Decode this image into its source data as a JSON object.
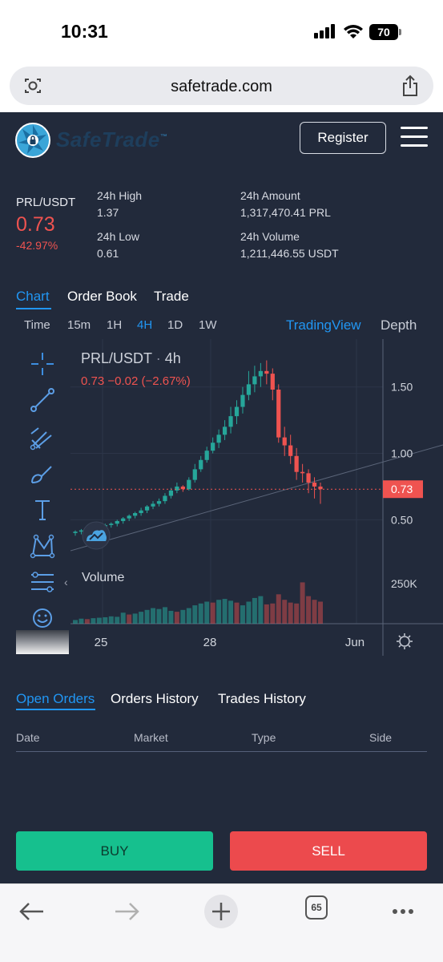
{
  "status_bar": {
    "time": "10:31",
    "battery": "70"
  },
  "browser": {
    "url": "safetrade.com",
    "tabs_count": "65"
  },
  "header": {
    "logo_text": "SafeTrade",
    "logo_tm": "™",
    "register_label": "Register"
  },
  "ticker": {
    "pair": "PRL/USDT",
    "price": "0.73",
    "change": "-42.97%",
    "high_label": "24h High",
    "high_value": "1.37",
    "low_label": "24h Low",
    "low_value": "0.61",
    "amount_label": "24h Amount",
    "amount_value": "1,317,470.41 PRL",
    "volume_label": "24h Volume",
    "volume_value": "1,211,446.55 USDT"
  },
  "main_tabs": [
    {
      "label": "Chart",
      "active": true
    },
    {
      "label": "Order Book",
      "active": false
    },
    {
      "label": "Trade",
      "active": false
    }
  ],
  "timeframes": {
    "time_label": "Time",
    "items": [
      "15m",
      "1H",
      "4H",
      "1D",
      "1W"
    ],
    "active": "4H",
    "tradingview_label": "TradingView",
    "depth_label": "Depth"
  },
  "chart": {
    "title_pair": "PRL/USDT",
    "title_sep": "·",
    "title_interval": "4h",
    "ohlc_text": "0.73  −0.02  (−2.67%)",
    "volume_label": "Volume",
    "price_ticks": [
      "1.50",
      "1.00",
      "0.50"
    ],
    "volume_tick": "250K",
    "current_price_tag": "0.73",
    "date_ticks": [
      "25",
      "28",
      "Jun"
    ]
  },
  "chart_data": {
    "type": "candlestick",
    "title": "PRL/USDT · 4h",
    "ylim": [
      0.2,
      1.8
    ],
    "current_price": 0.73,
    "y_ticks": [
      1.5,
      1.0,
      0.5
    ],
    "x_ticks": [
      "25",
      "28",
      "Jun"
    ],
    "candles": [
      {
        "o": 0.4,
        "h": 0.42,
        "c": 0.41,
        "l": 0.38
      },
      {
        "o": 0.41,
        "h": 0.43,
        "c": 0.42,
        "l": 0.39
      },
      {
        "o": 0.42,
        "h": 0.44,
        "c": 0.43,
        "l": 0.4
      },
      {
        "o": 0.43,
        "h": 0.45,
        "c": 0.44,
        "l": 0.41
      },
      {
        "o": 0.44,
        "h": 0.46,
        "c": 0.45,
        "l": 0.42
      },
      {
        "o": 0.45,
        "h": 0.47,
        "c": 0.46,
        "l": 0.43
      },
      {
        "o": 0.46,
        "h": 0.48,
        "c": 0.47,
        "l": 0.44
      },
      {
        "o": 0.47,
        "h": 0.5,
        "c": 0.49,
        "l": 0.45
      },
      {
        "o": 0.49,
        "h": 0.52,
        "c": 0.51,
        "l": 0.47
      },
      {
        "o": 0.51,
        "h": 0.54,
        "c": 0.53,
        "l": 0.49
      },
      {
        "o": 0.53,
        "h": 0.56,
        "c": 0.55,
        "l": 0.51
      },
      {
        "o": 0.55,
        "h": 0.59,
        "c": 0.57,
        "l": 0.53
      },
      {
        "o": 0.57,
        "h": 0.61,
        "c": 0.6,
        "l": 0.55
      },
      {
        "o": 0.6,
        "h": 0.64,
        "c": 0.62,
        "l": 0.58
      },
      {
        "o": 0.62,
        "h": 0.66,
        "c": 0.64,
        "l": 0.6
      },
      {
        "o": 0.64,
        "h": 0.7,
        "c": 0.68,
        "l": 0.62
      },
      {
        "o": 0.68,
        "h": 0.74,
        "c": 0.72,
        "l": 0.66
      },
      {
        "o": 0.72,
        "h": 0.78,
        "c": 0.75,
        "l": 0.7
      },
      {
        "o": 0.75,
        "h": 0.76,
        "c": 0.73,
        "l": 0.71
      },
      {
        "o": 0.73,
        "h": 0.82,
        "c": 0.8,
        "l": 0.72
      },
      {
        "o": 0.8,
        "h": 0.92,
        "c": 0.88,
        "l": 0.78
      },
      {
        "o": 0.88,
        "h": 0.98,
        "c": 0.95,
        "l": 0.86
      },
      {
        "o": 0.95,
        "h": 1.05,
        "c": 1.02,
        "l": 0.93
      },
      {
        "o": 1.02,
        "h": 1.12,
        "c": 1.08,
        "l": 1.0
      },
      {
        "o": 1.08,
        "h": 1.18,
        "c": 1.14,
        "l": 1.04
      },
      {
        "o": 1.14,
        "h": 1.25,
        "c": 1.2,
        "l": 1.1
      },
      {
        "o": 1.2,
        "h": 1.35,
        "c": 1.28,
        "l": 1.15
      },
      {
        "o": 1.28,
        "h": 1.4,
        "c": 1.35,
        "l": 1.22
      },
      {
        "o": 1.35,
        "h": 1.5,
        "c": 1.44,
        "l": 1.3
      },
      {
        "o": 1.44,
        "h": 1.62,
        "c": 1.52,
        "l": 1.4
      },
      {
        "o": 1.52,
        "h": 1.66,
        "c": 1.58,
        "l": 1.46
      },
      {
        "o": 1.58,
        "h": 1.68,
        "c": 1.62,
        "l": 1.5
      },
      {
        "o": 1.62,
        "h": 1.7,
        "c": 1.6,
        "l": 1.52
      },
      {
        "o": 1.6,
        "h": 1.64,
        "c": 1.48,
        "l": 1.4
      },
      {
        "o": 1.48,
        "h": 1.52,
        "c": 1.12,
        "l": 1.08
      },
      {
        "o": 1.12,
        "h": 1.2,
        "c": 1.06,
        "l": 0.98
      },
      {
        "o": 1.06,
        "h": 1.14,
        "c": 0.98,
        "l": 0.92
      },
      {
        "o": 0.98,
        "h": 1.04,
        "c": 0.86,
        "l": 0.8
      },
      {
        "o": 0.86,
        "h": 0.92,
        "c": 0.85,
        "l": 0.78
      },
      {
        "o": 0.85,
        "h": 0.88,
        "c": 0.78,
        "l": 0.7
      },
      {
        "o": 0.78,
        "h": 0.82,
        "c": 0.75,
        "l": 0.66
      },
      {
        "o": 0.75,
        "h": 0.78,
        "c": 0.73,
        "l": 0.62
      }
    ],
    "volume": [
      {
        "v": 40,
        "up": true
      },
      {
        "v": 55,
        "up": true
      },
      {
        "v": 50,
        "up": false
      },
      {
        "v": 60,
        "up": true
      },
      {
        "v": 65,
        "up": true
      },
      {
        "v": 70,
        "up": true
      },
      {
        "v": 80,
        "up": true
      },
      {
        "v": 75,
        "up": true
      },
      {
        "v": 120,
        "up": true
      },
      {
        "v": 100,
        "up": false
      },
      {
        "v": 110,
        "up": true
      },
      {
        "v": 130,
        "up": true
      },
      {
        "v": 150,
        "up": true
      },
      {
        "v": 170,
        "up": true
      },
      {
        "v": 160,
        "up": true
      },
      {
        "v": 180,
        "up": true
      },
      {
        "v": 140,
        "up": true
      },
      {
        "v": 130,
        "up": false
      },
      {
        "v": 150,
        "up": true
      },
      {
        "v": 170,
        "up": true
      },
      {
        "v": 200,
        "up": true
      },
      {
        "v": 220,
        "up": true
      },
      {
        "v": 240,
        "up": true
      },
      {
        "v": 230,
        "up": false
      },
      {
        "v": 260,
        "up": true
      },
      {
        "v": 270,
        "up": true
      },
      {
        "v": 250,
        "up": true
      },
      {
        "v": 230,
        "up": false
      },
      {
        "v": 200,
        "up": true
      },
      {
        "v": 240,
        "up": true
      },
      {
        "v": 280,
        "up": true
      },
      {
        "v": 300,
        "up": true
      },
      {
        "v": 210,
        "up": false
      },
      {
        "v": 220,
        "up": false
      },
      {
        "v": 320,
        "up": false
      },
      {
        "v": 260,
        "up": false
      },
      {
        "v": 230,
        "up": false
      },
      {
        "v": 220,
        "up": false
      },
      {
        "v": 450,
        "up": false
      },
      {
        "v": 300,
        "up": false
      },
      {
        "v": 260,
        "up": false
      },
      {
        "v": 240,
        "up": false
      }
    ]
  },
  "orders": {
    "tabs": [
      {
        "label": "Open Orders",
        "active": true
      },
      {
        "label": "Orders History",
        "active": false
      },
      {
        "label": "Trades History",
        "active": false
      }
    ],
    "columns": [
      "Date",
      "Market",
      "Type",
      "Side"
    ]
  },
  "actions": {
    "buy_label": "BUY",
    "sell_label": "SELL"
  },
  "colors": {
    "background": "#222a3b",
    "up": "#26a69a",
    "down": "#ef5350",
    "accent": "#2196f3",
    "buy": "#16c08e",
    "sell": "#ec4a4d"
  },
  "icons": [
    "crosshair-icon",
    "trend-line-icon",
    "pitchfork-icon",
    "brush-icon",
    "text-icon",
    "pattern-icon",
    "measure-icon",
    "emoji-icon",
    "settings-icon",
    "tradingview-logo-icon"
  ]
}
